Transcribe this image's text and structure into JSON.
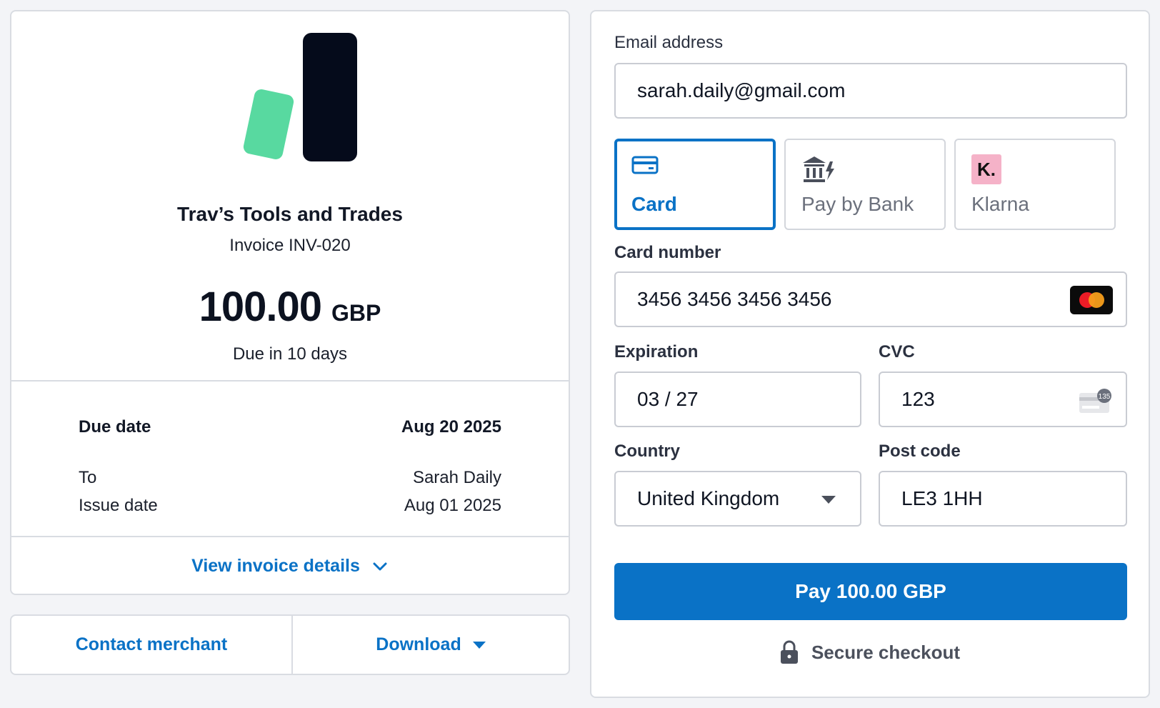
{
  "invoice": {
    "merchant_name": "Trav’s Tools and Trades",
    "invoice_number": "Invoice INV-020",
    "amount": "100.00",
    "currency": "GBP",
    "due_in": "Due in 10 days",
    "due_date_label": "Due date",
    "due_date_value": "Aug 20 2025",
    "to_label": "To",
    "to_value": "Sarah Daily",
    "issue_date_label": "Issue date",
    "issue_date_value": "Aug 01 2025",
    "view_details_label": "View invoice details"
  },
  "actions": {
    "contact_label": "Contact merchant",
    "download_label": "Download"
  },
  "payment": {
    "email_label": "Email address",
    "email_value": "sarah.daily@gmail.com",
    "methods": [
      {
        "label": "Card",
        "icon": "card-icon",
        "selected": true
      },
      {
        "label": "Pay by Bank",
        "icon": "bank-icon",
        "selected": false
      },
      {
        "label": "Klarna",
        "icon": "klarna-icon",
        "selected": false,
        "badge": "K."
      }
    ],
    "card_number_label": "Card number",
    "card_number_value": "3456 3456 3456 3456",
    "card_brand_icon": "mastercard-icon",
    "expiration_label": "Expiration",
    "expiration_value": "03 / 27",
    "cvc_label": "CVC",
    "cvc_value": "123",
    "cvc_hint": "135",
    "country_label": "Country",
    "country_value": "United Kingdom",
    "postcode_label": "Post code",
    "postcode_value": "LE3 1HH",
    "pay_button_label": "Pay 100.00 GBP",
    "secure_label": "Secure checkout"
  },
  "colors": {
    "accent": "#0a72c6",
    "logo_green": "#58d9a0",
    "logo_dark": "#050b1b",
    "klarna_pink": "#f5b2c8"
  }
}
